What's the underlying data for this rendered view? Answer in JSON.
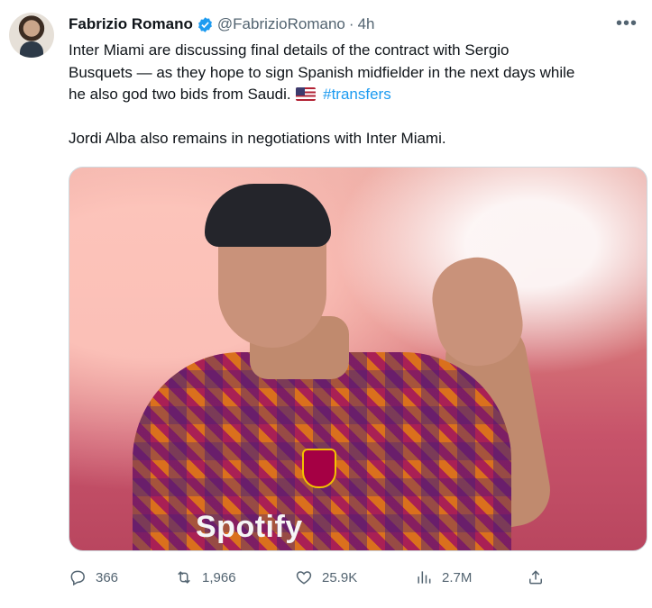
{
  "author": {
    "name": "Fabrizio Romano",
    "handle": "@FabrizioRomano",
    "separator": "·",
    "time": "4h"
  },
  "tweet": {
    "line1": "Inter Miami are discussing final details of the contract with Sergio",
    "line2": "Busquets — as they hope to sign Spanish midfielder in the next days while",
    "line3_text": "he also god two bids from Saudi.",
    "hashtag": "#transfers",
    "line4": "Jordi Alba also remains in negotiations with Inter Miami."
  },
  "media": {
    "sponsor_text": "Spotify"
  },
  "actions": {
    "replies": "366",
    "retweets": "1,966",
    "likes": "25.9K",
    "views": "2.7M"
  },
  "colors": {
    "link": "#1d9bf0",
    "muted": "#536471",
    "text": "#0f1419"
  },
  "icons": [
    "verified-badge-icon",
    "more-icon",
    "reply-icon",
    "retweet-icon",
    "like-icon",
    "views-icon",
    "share-icon",
    "usa-flag-icon"
  ]
}
